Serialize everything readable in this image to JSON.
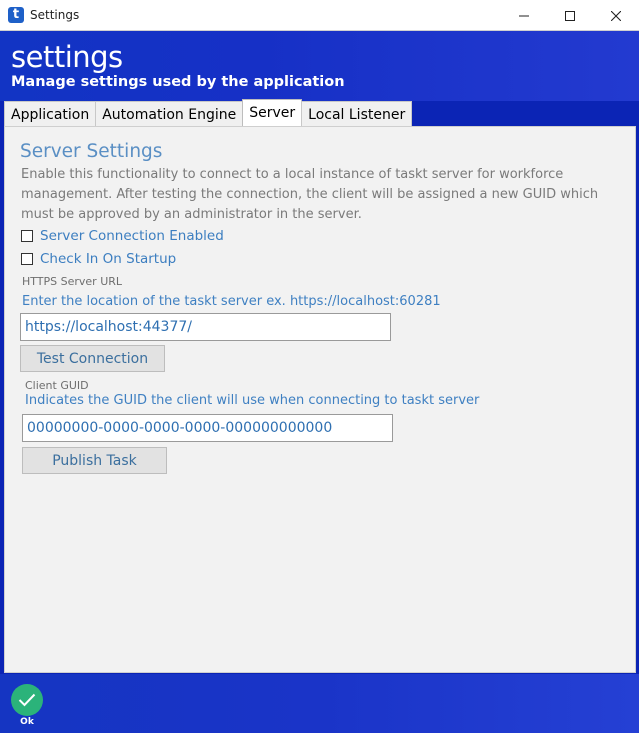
{
  "window": {
    "title": "Settings",
    "app_icon_glyph": "t",
    "controls": [
      "minimize-icon",
      "maximize-icon",
      "close-icon"
    ]
  },
  "header": {
    "title": "settings",
    "subtitle": "Manage settings used by the application"
  },
  "tabs": [
    {
      "label": "Application",
      "active": false
    },
    {
      "label": "Automation Engine",
      "active": false
    },
    {
      "label": "Server",
      "active": true
    },
    {
      "label": "Local Listener",
      "active": false
    }
  ],
  "server": {
    "section_title": "Server Settings",
    "description": "Enable this functionality to connect to a local instance of taskt server for workforce management.  After testing the connection, the client will be assigned a new GUID which must be approved by an administrator in the server.",
    "checkbox_enabled_label": "Server Connection Enabled",
    "checkbox_enabled_checked": false,
    "checkbox_startup_label": "Check In On Startup",
    "checkbox_startup_checked": false,
    "url_label": "HTTPS Server URL",
    "url_hint": "Enter the location of the taskt server ex. https://localhost:60281",
    "url_value": "https://localhost:44377/",
    "test_button": "Test Connection",
    "guid_label": "Client GUID",
    "guid_hint": "Indicates the GUID the client will use when connecting to taskt server",
    "guid_value": "00000000-0000-0000-0000-000000000000",
    "publish_button": "Publish Task"
  },
  "footer": {
    "ok_label": "Ok",
    "ok_icon": "checkmark-icon"
  },
  "colors": {
    "brand_blue": "#1630c6",
    "accent_text": "#3f80c2",
    "ok_green": "#2bb37a"
  }
}
